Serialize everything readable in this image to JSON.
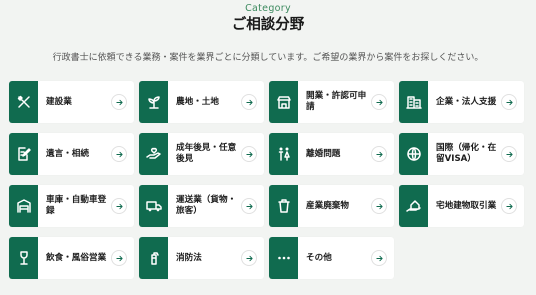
{
  "header": {
    "category_label": "Category",
    "title": "ご相談分野",
    "intro": "行政書士に依頼できる業務・案件を業界ごとに分類しています。ご希望の業界から案件をお探しください。"
  },
  "colors": {
    "accent": "#106b4f",
    "label_green": "#3c8a5f",
    "background": "#f2f4f2"
  },
  "categories": [
    {
      "label": "建設業",
      "icon": "tools-icon"
    },
    {
      "label": "農地・土地",
      "icon": "sprout-icon"
    },
    {
      "label": "開業・許認可申請",
      "icon": "shop-icon"
    },
    {
      "label": "企業・法人支援",
      "icon": "building-icon"
    },
    {
      "label": "遺言・相続",
      "icon": "document-pen-icon"
    },
    {
      "label": "成年後見・任意後見",
      "icon": "hand-care-icon"
    },
    {
      "label": "離婚問題",
      "icon": "couple-icon"
    },
    {
      "label": "国際（帰化・在留VISA）",
      "icon": "globe-icon"
    },
    {
      "label": "車庫・自動車登録",
      "icon": "garage-icon"
    },
    {
      "label": "運送業（貨物・旅客）",
      "icon": "truck-icon"
    },
    {
      "label": "産業廃棄物",
      "icon": "trash-icon"
    },
    {
      "label": "宅地建物取引業",
      "icon": "house-hand-icon"
    },
    {
      "label": "飲食・風俗営業",
      "icon": "wine-glass-icon"
    },
    {
      "label": "消防法",
      "icon": "fire-extinguisher-icon"
    },
    {
      "label": "その他",
      "icon": "dots-icon"
    }
  ]
}
